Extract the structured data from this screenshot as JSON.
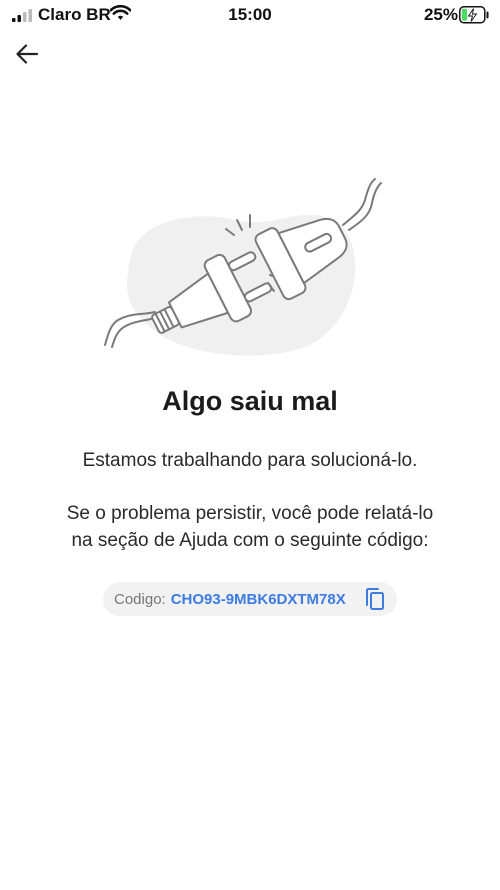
{
  "status_bar": {
    "carrier": "Claro BR",
    "time": "15:00",
    "battery_percent": "25%",
    "battery_level": 0.25,
    "icons": [
      "signal-icon",
      "wifi-icon",
      "battery-charging-icon"
    ]
  },
  "nav": {
    "back_icon": "arrow-left-icon"
  },
  "illustration": {
    "icon": "unplugged-plug-illustration"
  },
  "error": {
    "title": "Algo saiu mal",
    "message": "Estamos trabalhando para solucioná-lo.",
    "help_line1": "Se o problema persistir, você pode relatá-lo",
    "help_line2": "na seção de Ajuda com o seguinte código:"
  },
  "code": {
    "label": "Codigo:",
    "value": "CHO93-9MBK6DXTM78X",
    "copy_icon": "copy-icon"
  },
  "colors": {
    "accent": "#3d7be5",
    "battery_fill": "#4cd964",
    "pill_bg": "#f2f2f2"
  }
}
